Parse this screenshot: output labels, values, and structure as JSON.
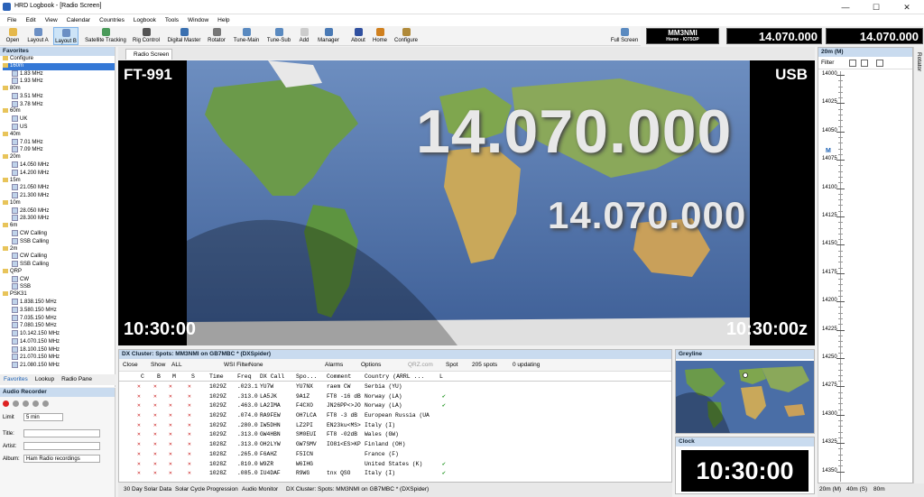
{
  "window": {
    "title": "HRD Logbook - [Radio Screen]",
    "minimize": "—",
    "maximize": "☐",
    "close": "✕"
  },
  "menu": [
    "File",
    "Edit",
    "View",
    "Calendar",
    "Countries",
    "Logbook",
    "Tools",
    "Window",
    "Help"
  ],
  "toolbar": {
    "buttons": [
      {
        "label": "Open",
        "icon": "folder-icon",
        "color": "#e5b84b"
      },
      {
        "label": "Layout A",
        "icon": "layout-icon",
        "color": "#6b8fc4"
      },
      {
        "label": "Layout B",
        "icon": "layout-icon",
        "color": "#6b8fc4"
      },
      {
        "label": "Satellite Tracking",
        "icon": "satellite-icon",
        "color": "#4a9a5a"
      },
      {
        "label": "Rig Control",
        "icon": "radio-icon",
        "color": "#555555"
      },
      {
        "label": "Digital Master",
        "icon": "digital-icon",
        "color": "#3a70b0"
      },
      {
        "label": "Rotator",
        "icon": "rotator-icon",
        "color": "#777777"
      },
      {
        "label": "Tune-Main",
        "icon": "tune-icon",
        "color": "#5a8ac0"
      },
      {
        "label": "Tune-Sub",
        "icon": "tune-icon",
        "color": "#5a8ac0"
      },
      {
        "label": "Add",
        "icon": "add-icon",
        "color": "#cccccc"
      },
      {
        "label": "Manager",
        "icon": "manager-icon",
        "color": "#4a7ab5"
      },
      {
        "label": "About",
        "icon": "about-icon",
        "color": "#3050a0"
      },
      {
        "label": "Home",
        "icon": "home-icon",
        "color": "#d0801e"
      },
      {
        "label": "Configure",
        "icon": "configure-icon",
        "color": "#b08a3a"
      },
      {
        "label": "Full Screen",
        "icon": "fullscreen-icon",
        "color": "#5a8ac0"
      }
    ],
    "callsign": "MM3NMI",
    "callsign_sub": "Home - IO75OP",
    "freq1": "14.070.000",
    "freq2": "14.070.000"
  },
  "favorites": {
    "title": "Favorites",
    "items": [
      {
        "t": "Configure",
        "k": "fold"
      },
      {
        "t": "160m",
        "k": "fold",
        "hl": true
      },
      {
        "t": "1.83 MHz",
        "k": "fr"
      },
      {
        "t": "1.93 MHz",
        "k": "fr"
      },
      {
        "t": "80m",
        "k": "fold"
      },
      {
        "t": "3.51 MHz",
        "k": "fr"
      },
      {
        "t": "3.78 MHz",
        "k": "fr"
      },
      {
        "t": "60m",
        "k": "fold"
      },
      {
        "t": "UK",
        "k": "fr"
      },
      {
        "t": "US",
        "k": "fr"
      },
      {
        "t": "40m",
        "k": "fold"
      },
      {
        "t": "7.01 MHz",
        "k": "fr"
      },
      {
        "t": "7.09 MHz",
        "k": "fr"
      },
      {
        "t": "20m",
        "k": "fold"
      },
      {
        "t": "14.050 MHz",
        "k": "fr"
      },
      {
        "t": "14.200 MHz",
        "k": "fr"
      },
      {
        "t": "15m",
        "k": "fold"
      },
      {
        "t": "21.050 MHz",
        "k": "fr"
      },
      {
        "t": "21.300 MHz",
        "k": "fr"
      },
      {
        "t": "10m",
        "k": "fold"
      },
      {
        "t": "28.050 MHz",
        "k": "fr"
      },
      {
        "t": "28.300 MHz",
        "k": "fr"
      },
      {
        "t": "6m",
        "k": "fold"
      },
      {
        "t": "CW Calling",
        "k": "fr"
      },
      {
        "t": "SSB Calling",
        "k": "fr"
      },
      {
        "t": "2m",
        "k": "fold"
      },
      {
        "t": "CW Calling",
        "k": "fr"
      },
      {
        "t": "SSB Calling",
        "k": "fr"
      },
      {
        "t": "QRP",
        "k": "fold"
      },
      {
        "t": "CW",
        "k": "fr"
      },
      {
        "t": "SSB",
        "k": "fr"
      },
      {
        "t": "PSK31",
        "k": "fold"
      },
      {
        "t": "1.838.150 MHz",
        "k": "fr"
      },
      {
        "t": "3.580.150 MHz",
        "k": "fr"
      },
      {
        "t": "7.035.150 MHz",
        "k": "fr"
      },
      {
        "t": "7.080.150 MHz",
        "k": "fr"
      },
      {
        "t": "10.142.150 MHz",
        "k": "fr"
      },
      {
        "t": "14.070.150 MHz",
        "k": "fr"
      },
      {
        "t": "18.100.150 MHz",
        "k": "fr"
      },
      {
        "t": "21.070.150 MHz",
        "k": "fr"
      },
      {
        "t": "21.080.150 MHz",
        "k": "fr"
      }
    ],
    "tabs": [
      "Favorites",
      "Lookup",
      "Radio Pane"
    ]
  },
  "audio": {
    "title": "Audio Recorder",
    "limit_label": "Limit",
    "limit_value": "5 min",
    "title_label": "Title:",
    "artist_label": "Artist:",
    "album_label": "Album:",
    "album_value": "Ham Radio recordings"
  },
  "radio": {
    "tab": "Radio Screen",
    "rig": "FT-991",
    "mode": "USB",
    "main_freq": "14.070.000",
    "sub_freq": "14.070.000",
    "time_left": "10:30:00",
    "time_right": "10:30:00z"
  },
  "dx": {
    "title": "DX Cluster: Spots: MM3NMI on GB7MBC * (DXSpider)",
    "close": "Close",
    "show": "Show",
    "show_value": "ALL",
    "wsi": "WSI Filter",
    "wsi_value": "None",
    "alarms": "Alarms",
    "options": "Options",
    "qrz": "QRZ.com",
    "spot": "Spot",
    "spots_count": "205 spots",
    "updating": "0 updating",
    "headers": [
      "C",
      "B",
      "M",
      "S",
      "Time",
      "Freq",
      "DX Call",
      "Spo...",
      "Comment",
      "Country (ARRL ...",
      "L"
    ],
    "rows": [
      {
        "time": "1029Z",
        "freq": ".023.1",
        "call": "YU7W",
        "spotter": "YU7NX",
        "comment": "raem CW",
        "country": "Serbia (YU)",
        "l": ""
      },
      {
        "time": "1029Z",
        "freq": ".313.0",
        "call": "LA5JK",
        "spotter": "9A1Z",
        "comment": "FT8 -16 dB",
        "country": "Norway (LA)",
        "l": "✔"
      },
      {
        "time": "1029Z",
        "freq": ".463.0",
        "call": "LA2IMA",
        "spotter": "F4CXO",
        "comment": "JN26PP<>JO",
        "country": "Norway (LA)",
        "l": "✔"
      },
      {
        "time": "1029Z",
        "freq": ".074.0",
        "call": "RA9FEW",
        "spotter": "OH7LCA",
        "comment": "FT8 -3 dB",
        "country": "European Russia (UA",
        "l": ""
      },
      {
        "time": "1029Z",
        "freq": ".280.0",
        "call": "IW5DHN",
        "spotter": "LZ2PI",
        "comment": "EN23ku<MS>",
        "country": "Italy (I)",
        "l": ""
      },
      {
        "time": "1029Z",
        "freq": ".313.0",
        "call": "GW4HBN",
        "spotter": "SM0EUI",
        "comment": "FT8 -02dB",
        "country": "Wales (GW)",
        "l": ""
      },
      {
        "time": "1028Z",
        "freq": ".313.0",
        "call": "OH2LYW",
        "spotter": "GW7SMV",
        "comment": "IO81<ES>KP",
        "country": "Finland (OH)",
        "l": ""
      },
      {
        "time": "1028Z",
        "freq": ".265.0",
        "call": "F6AHZ",
        "spotter": "F5ICN",
        "comment": "",
        "country": "France (F)",
        "l": ""
      },
      {
        "time": "1028Z",
        "freq": ".810.0",
        "call": "W9ZR",
        "spotter": "W6IHG",
        "comment": "",
        "country": "United States (K)",
        "l": "✔"
      },
      {
        "time": "1028Z",
        "freq": ".085.0",
        "call": "IU4DAF",
        "spotter": "R9WG",
        "comment": "tnx QSO",
        "country": "Italy (I)",
        "l": "✔"
      }
    ]
  },
  "greyline": {
    "title": "Greyline"
  },
  "clock": {
    "title": "Clock",
    "time": "10:30:00"
  },
  "bandplan": {
    "title": "20m (M)",
    "filter": "Filter",
    "marker": "M",
    "ticks": [
      "14000",
      "14025",
      "14050",
      "14075",
      "14100",
      "14125",
      "14150",
      "14175",
      "14200",
      "14225",
      "14250",
      "14275",
      "14300",
      "14325",
      "14350"
    ],
    "tabs": [
      "20m (M)",
      "40m (S)",
      "80m"
    ],
    "side": "Rotator"
  },
  "bottom_tabs": [
    "30 Day Solar Data",
    "Solar Cycle Progression",
    "Audio Monitor",
    "DX Cluster: Spots: MM3NMI on GB7MBC * (DXSpider)"
  ]
}
